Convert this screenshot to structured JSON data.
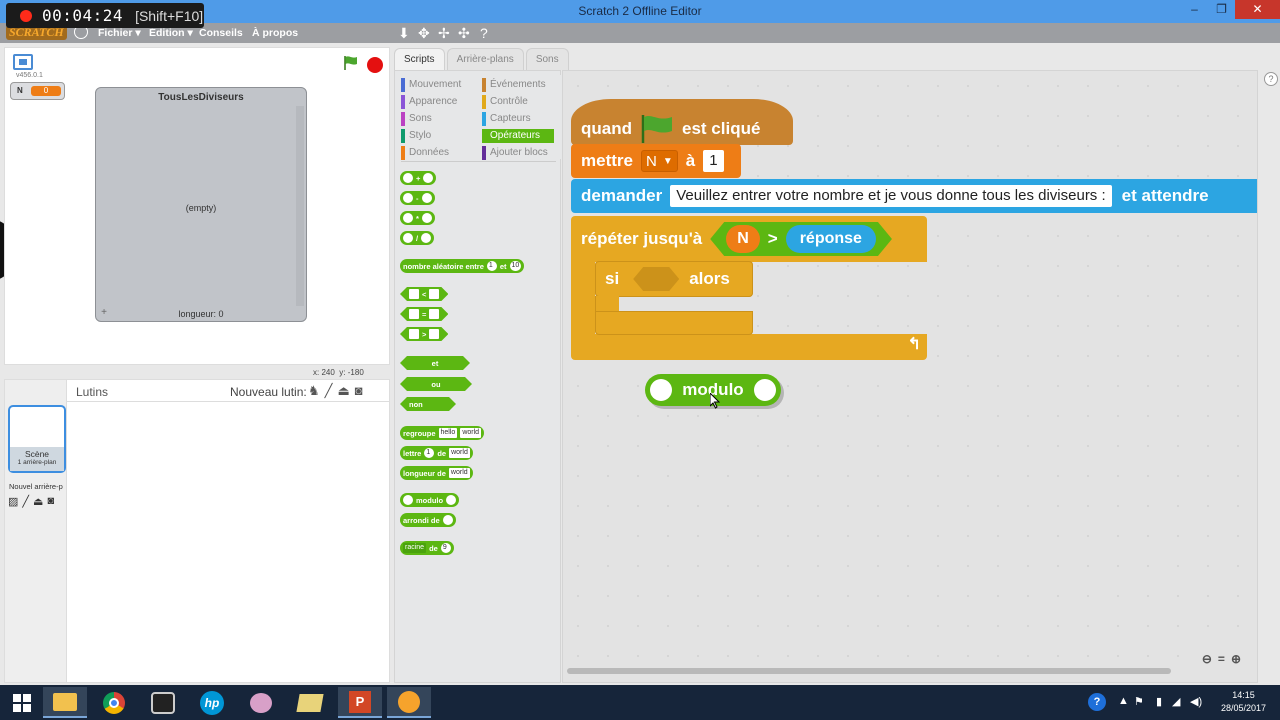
{
  "recorder": {
    "time": "00:04:24",
    "hotkey": "[Shift+F10]"
  },
  "window": {
    "title": "Scratch 2 Offline Editor",
    "minimize": "–",
    "maximize": "❐",
    "close": "✕"
  },
  "menubar": {
    "logo": "SCRATCH",
    "items": [
      "Fichier ▾",
      "Édition ▾",
      "Conseils",
      "À propos"
    ]
  },
  "stage": {
    "version": "v456.0.1",
    "variable_monitor": {
      "name": "N",
      "value": "0"
    },
    "list_monitor": {
      "title": "TousLesDiviseurs",
      "empty_text": "(empty)",
      "add": "+",
      "length_text": "longueur: 0"
    },
    "coords": {
      "x_label": "x:",
      "x_value": "240",
      "y_label": "y:",
      "y_value": "-180"
    }
  },
  "sprites": {
    "header": "Lutins",
    "new_sprite_label": "Nouveau lutin:",
    "scene_name": "Scène",
    "scene_sub": "1 arrière-plan",
    "new_backdrop_label": "Nouvel arrière-p"
  },
  "tabs": [
    "Scripts",
    "Arrière-plans",
    "Sons"
  ],
  "categories": {
    "left": [
      {
        "label": "Mouvement",
        "color": "#4a6cd4"
      },
      {
        "label": "Apparence",
        "color": "#8a55d7"
      },
      {
        "label": "Sons",
        "color": "#bb42c3"
      },
      {
        "label": "Stylo",
        "color": "#0e9a6c"
      },
      {
        "label": "Données",
        "color": "#ee7d16"
      }
    ],
    "right": [
      {
        "label": "Événements",
        "color": "#c88330"
      },
      {
        "label": "Contrôle",
        "color": "#e1a91a"
      },
      {
        "label": "Capteurs",
        "color": "#2ca5e2"
      },
      {
        "label": "Opérateurs",
        "color": "#5cb712"
      },
      {
        "label": "Ajouter blocs",
        "color": "#632d99"
      }
    ]
  },
  "palette": {
    "op_plus": "+",
    "op_minus": "-",
    "op_times": "*",
    "op_div": "/",
    "random": {
      "label": "nombre aléatoire entre",
      "from": "1",
      "and": "et",
      "to": "10"
    },
    "lt": "<",
    "eq": "=",
    "gt": ">",
    "and": "et",
    "or": "ou",
    "not": "non",
    "join": {
      "label": "regroupe",
      "a": "hello",
      "b": "world"
    },
    "letter": {
      "label": "lettre",
      "n": "1",
      "of": "de",
      "s": "world"
    },
    "length": {
      "label": "longueur de",
      "s": "world"
    },
    "mod": "modulo",
    "round": "arrondi de",
    "math": {
      "fn": "racine",
      "of": "de",
      "v": "9"
    }
  },
  "script": {
    "hat": {
      "when": "quand",
      "clicked": "est cliqué"
    },
    "set": {
      "label": "mettre",
      "var": "N",
      "to": "à",
      "value": "1"
    },
    "ask": {
      "label": "demander",
      "question": "Veuillez entrer votre nombre et je vous donne tous les diviseurs :",
      "wait": "et attendre"
    },
    "repeat": {
      "label": "répéter jusqu'à",
      "var": "N",
      "op": ">",
      "answer": "réponse"
    },
    "if": {
      "label": "si",
      "then": "alors"
    },
    "loose": {
      "label": "modulo"
    }
  },
  "taskbar": {
    "time": "14:15",
    "date": "28/05/2017"
  }
}
